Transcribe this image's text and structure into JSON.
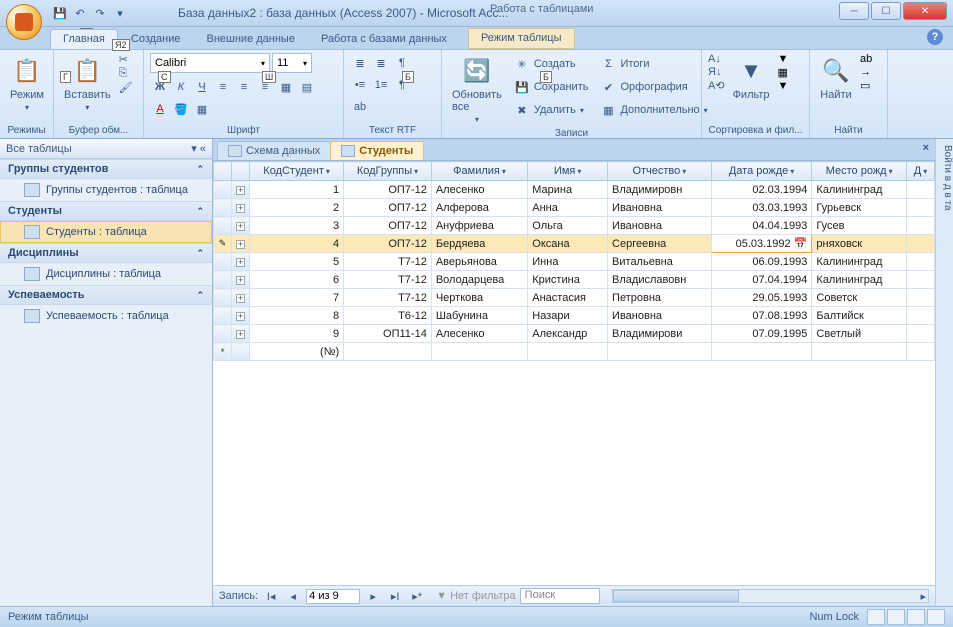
{
  "title": "База данных2 : база данных (Access 2007) - Microsoft Acc...",
  "contextual_title": "Работа с таблицами",
  "keytips": {
    "f": "Ф",
    "y1": "Я",
    "y2": "Я2",
    "g": "Г",
    "s": "С",
    "sh": "Ш",
    "b": "Б",
    "b2": "Б"
  },
  "tabs": {
    "home": "Главная",
    "create": "Создание",
    "external": "Внешние данные",
    "dbtools": "Работа с базами данных",
    "datasheet": "Режим таблицы"
  },
  "ribbon": {
    "views": {
      "label": "Режимы",
      "mode": "Режим"
    },
    "clipboard": {
      "label": "Буфер обм...",
      "paste": "Вставить"
    },
    "font": {
      "label": "Шрифт",
      "name": "Calibri",
      "size": "11"
    },
    "richtext": {
      "label": "Текст RTF"
    },
    "records": {
      "label": "Записи",
      "refresh": "Обновить все",
      "new": "Создать",
      "save": "Сохранить",
      "delete": "Удалить",
      "totals": "Итоги",
      "spelling": "Орфография",
      "more": "Дополнительно"
    },
    "sortfilter": {
      "label": "Сортировка и фил...",
      "filter": "Фильтр"
    },
    "find": {
      "label": "Найти",
      "find": "Найти"
    }
  },
  "nav": {
    "header": "Все таблицы",
    "groups": [
      {
        "title": "Группы студентов",
        "items": [
          "Группы студентов : таблица"
        ]
      },
      {
        "title": "Студенты",
        "items": [
          "Студенты : таблица"
        ],
        "selected": 0
      },
      {
        "title": "Дисциплины",
        "items": [
          "Дисциплины : таблица"
        ]
      },
      {
        "title": "Успеваемость",
        "items": [
          "Успеваемость : таблица"
        ]
      }
    ]
  },
  "doctabs": [
    {
      "label": "Схема данных",
      "active": false
    },
    {
      "label": "Студенты",
      "active": true
    }
  ],
  "columns": [
    "КодСтудент",
    "КодГруппы",
    "Фамилия",
    "Имя",
    "Отчество",
    "Дата рожде",
    "Место рожд",
    "Д"
  ],
  "rows": [
    {
      "id": "1",
      "grp": "ОП7-12",
      "fam": "Алесенко",
      "name": "Марина",
      "otch": "Владимировн",
      "date": "02.03.1994",
      "place": "Калининград"
    },
    {
      "id": "2",
      "grp": "ОП7-12",
      "fam": "Алферова",
      "name": "Анна",
      "otch": "Ивановна",
      "date": "03.03.1993",
      "place": "Гурьевск"
    },
    {
      "id": "3",
      "grp": "ОП7-12",
      "fam": "Ануфриева",
      "name": "Ольга",
      "otch": "Ивановна",
      "date": "04.04.1993",
      "place": "Гусев"
    },
    {
      "id": "4",
      "grp": "ОП7-12",
      "fam": "Бердяева",
      "name": "Оксана",
      "otch": "Сергеевна",
      "date": "05.03.1992",
      "place": "рняховск",
      "selected": true
    },
    {
      "id": "5",
      "grp": "Т7-12",
      "fam": "Аверьянова",
      "name": "Инна",
      "otch": "Витальевна",
      "date": "06.09.1993",
      "place": "Калининград"
    },
    {
      "id": "6",
      "grp": "Т7-12",
      "fam": "Володарцева",
      "name": "Кристина",
      "otch": "Владиславовн",
      "date": "07.04.1994",
      "place": "Калининград"
    },
    {
      "id": "7",
      "grp": "Т7-12",
      "fam": "Черткова",
      "name": "Анастасия",
      "otch": "Петровна",
      "date": "29.05.1993",
      "place": "Советск"
    },
    {
      "id": "8",
      "grp": "Т6-12",
      "fam": "Шабунина",
      "name": "Назари",
      "otch": "Ивановна",
      "date": "07.08.1993",
      "place": "Балтийск"
    },
    {
      "id": "9",
      "grp": "ОП11-14",
      "fam": "Алесенко",
      "name": "Александр",
      "otch": "Владимирови",
      "date": "07.09.1995",
      "place": "Светлый"
    }
  ],
  "newrow_id": "(№)",
  "recnav": {
    "label": "Запись:",
    "pos": "4 из 9",
    "nofilter": "Нет фильтра",
    "search": "Поиск"
  },
  "status": {
    "mode": "Режим таблицы",
    "numlock": "Num Lock"
  },
  "taskpane_text": "Войти в д в та"
}
